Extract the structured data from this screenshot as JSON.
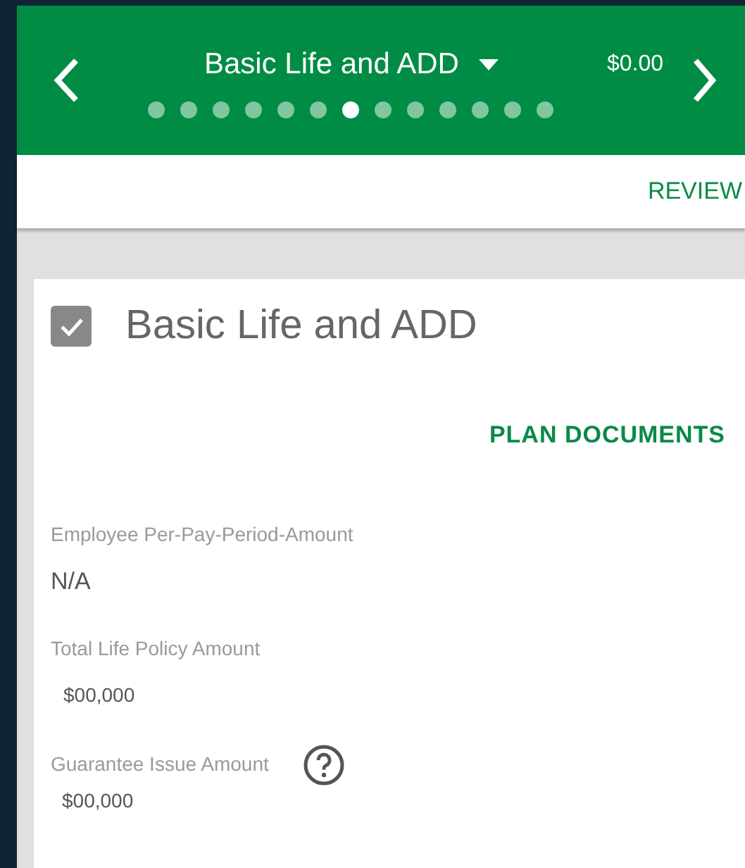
{
  "header": {
    "title": "Basic Life and ADD",
    "amount": "$0.00",
    "pages": [
      {
        "selected": false
      },
      {
        "selected": false
      },
      {
        "selected": false
      },
      {
        "selected": false
      },
      {
        "selected": false
      },
      {
        "selected": false
      },
      {
        "selected": true
      },
      {
        "selected": false
      },
      {
        "selected": false
      },
      {
        "selected": false
      },
      {
        "selected": false
      },
      {
        "selected": false
      },
      {
        "selected": false
      }
    ]
  },
  "review_link": "REVIEW",
  "plan": {
    "title": "Basic Life and ADD",
    "checked": true,
    "documents_link": "PLAN DOCUMENTS",
    "fields": [
      {
        "kind": "large",
        "label": "Employee Per-Pay-Period-Amount",
        "value": "N/A",
        "help": false
      },
      {
        "kind": "small",
        "label": "Total Life Policy Amount",
        "value": "$00,000",
        "help": false
      },
      {
        "kind": "small",
        "label": "Guarantee Issue Amount",
        "value": "$00,000",
        "help": true
      }
    ]
  }
}
